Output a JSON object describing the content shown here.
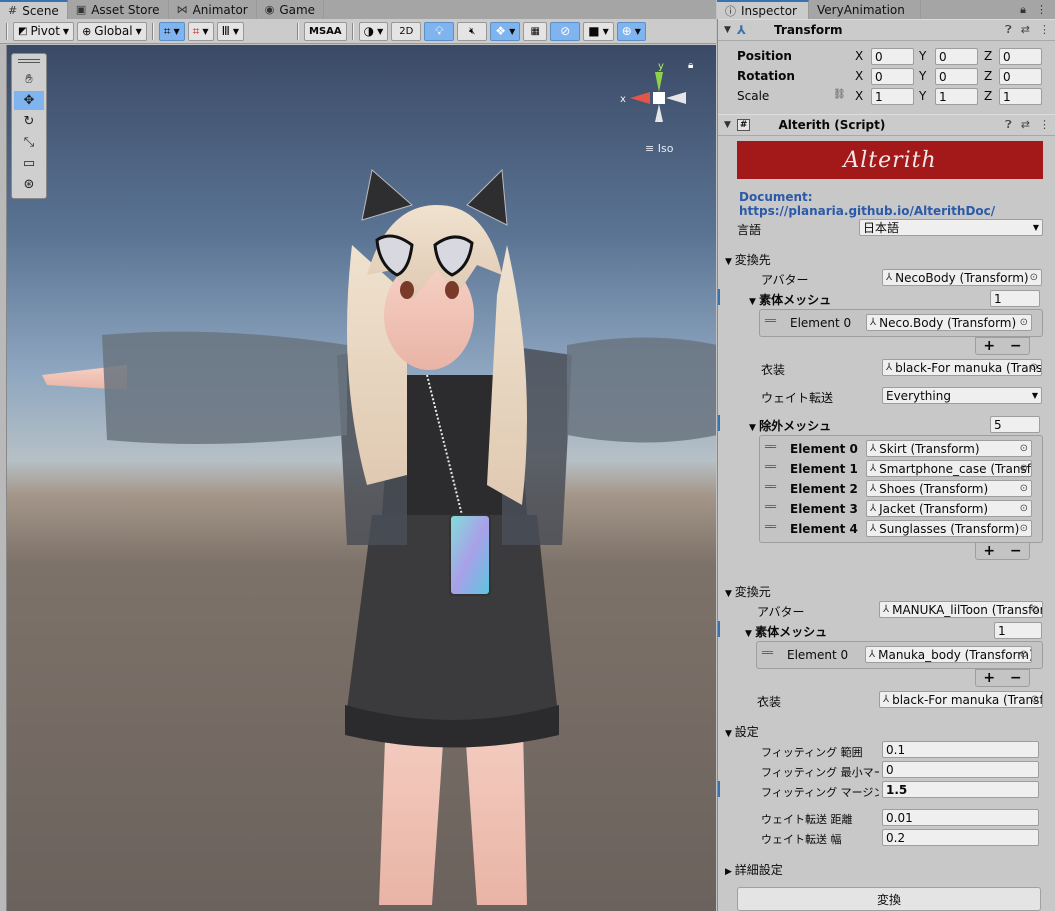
{
  "scene_tabs": [
    {
      "label": "Scene",
      "icon": "#"
    },
    {
      "label": "Asset Store",
      "icon": "▣"
    },
    {
      "label": "Animator",
      "icon": "⋈"
    },
    {
      "label": "Game",
      "icon": "◉"
    }
  ],
  "inspector_tabs": [
    {
      "label": "Inspector",
      "icon": "ⓘ"
    },
    {
      "label": "VeryAnimation",
      "icon": ""
    }
  ],
  "toolbar": {
    "pivot": "Pivot",
    "global": "Global",
    "msaa": "MSAA",
    "mode2d": "2D"
  },
  "scene": {
    "iso_label": "Iso",
    "gizmo_y": "y",
    "gizmo_x": "x"
  },
  "transform": {
    "title": "Transform",
    "position_label": "Position",
    "rotation_label": "Rotation",
    "scale_label": "Scale",
    "position": {
      "x": "0",
      "y": "0",
      "z": "0"
    },
    "rotation": {
      "x": "0",
      "y": "0",
      "z": "0"
    },
    "scale": {
      "x": "1",
      "y": "1",
      "z": "1"
    }
  },
  "script": {
    "title": "Alterith (Script)",
    "banner": "Alterith",
    "doc_link": "Document: https://planaria.github.io/AlterithDoc/",
    "language_label": "言語",
    "language_value": "日本語"
  },
  "target": {
    "section": "変換先",
    "avatar_label": "アバター",
    "avatar_value": "NecoBody (Transform)",
    "body_mesh_label": "素体メッシュ",
    "body_mesh_count": "1",
    "body_mesh_elements": [
      {
        "label": "Element 0",
        "value": "Neco.Body (Transform)"
      }
    ],
    "costume_label": "衣装",
    "costume_value": "black-For manuka (Transform)",
    "weight_label": "ウェイト転送",
    "weight_value": "Everything",
    "exclude_label": "除外メッシュ",
    "exclude_count": "5",
    "exclude_elements": [
      {
        "label": "Element 0",
        "value": "Skirt (Transform)"
      },
      {
        "label": "Element 1",
        "value": "Smartphone_case (Transform)"
      },
      {
        "label": "Element 2",
        "value": "Shoes (Transform)"
      },
      {
        "label": "Element 3",
        "value": "Jacket (Transform)"
      },
      {
        "label": "Element 4",
        "value": "Sunglasses (Transform)"
      }
    ]
  },
  "source": {
    "section": "変換元",
    "avatar_label": "アバター",
    "avatar_value": "MANUKA_lilToon (Transform)",
    "body_mesh_label": "素体メッシュ",
    "body_mesh_count": "1",
    "body_mesh_elements": [
      {
        "label": "Element 0",
        "value": "Manuka_body (Transform)"
      }
    ],
    "costume_label": "衣装",
    "costume_value": "black-For manuka (Transform)"
  },
  "settings": {
    "section": "設定",
    "fields": [
      {
        "label": "フィッティング 範囲",
        "value": "0.1"
      },
      {
        "label": "フィッティング 最小マージン",
        "value": "0"
      },
      {
        "label": "フィッティング マージン",
        "value": "1.5"
      },
      {
        "label": "ウェイト転送 距離",
        "value": "0.01"
      },
      {
        "label": "ウェイト転送 幅",
        "value": "0.2"
      }
    ],
    "advanced": "詳細設定",
    "convert_button": "変換"
  }
}
